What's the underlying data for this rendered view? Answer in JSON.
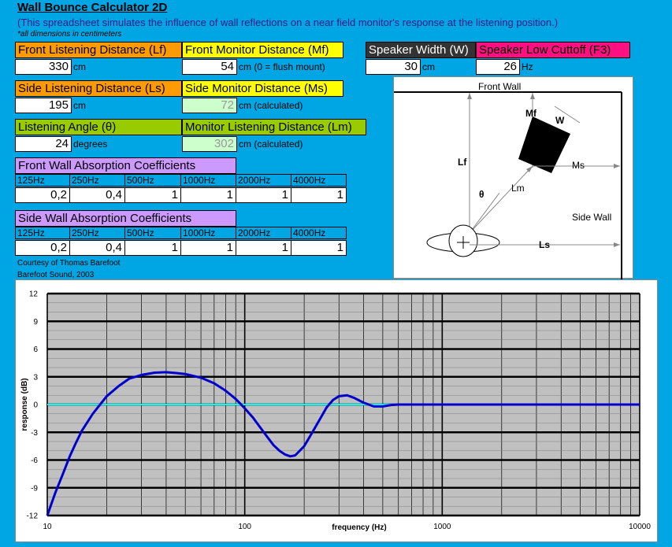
{
  "header": {
    "title": "Wall Bounce Calculator 2D",
    "subtitle": "(This spreadsheet simulates the influence of wall reflections on a near field monitor's response at the listening position.)",
    "note": "*all dimensions in centimeters"
  },
  "inputs": {
    "front_listening": {
      "label": "Front Listening Distance (Lf)",
      "value": "330",
      "unit": "cm"
    },
    "front_monitor": {
      "label": "Front Monitor Distance (Mf)",
      "value": "54",
      "unit": "cm  (0 = flush mount)"
    },
    "speaker_width": {
      "label": "Speaker Width (W)",
      "value": "30",
      "unit": "cm"
    },
    "low_cutoff": {
      "label": "Speaker Low Cuttoff (F3)",
      "value": "26",
      "unit": "Hz"
    },
    "side_listening": {
      "label": "Side Listening Distance (Ls)",
      "value": "195",
      "unit": "cm"
    },
    "side_monitor": {
      "label": "Side Monitor Distance (Ms)",
      "value": "72",
      "unit": "cm  (calculated)"
    },
    "listening_angle": {
      "label": "Listening Angle (θ)",
      "value": "24",
      "unit": "degrees"
    },
    "monitor_listening": {
      "label": "Monitor Listening Distance (Lm)",
      "value": "302",
      "unit": "cm  (calculated)"
    }
  },
  "absorption": {
    "front": {
      "label": "Front Wall Absorption Coefficients",
      "bands": [
        "125Hz",
        "250Hz",
        "500Hz",
        "1000Hz",
        "2000Hz",
        "4000Hz"
      ],
      "values": [
        "0,2",
        "0,4",
        "1",
        "1",
        "1",
        "1"
      ]
    },
    "side": {
      "label": "Side Wall Absorption Coefficients",
      "bands": [
        "125Hz",
        "250Hz",
        "500Hz",
        "1000Hz",
        "2000Hz",
        "4000Hz"
      ],
      "values": [
        "0,2",
        "0,4",
        "1",
        "1",
        "1",
        "1"
      ]
    }
  },
  "credits": {
    "line1": "Courtesy of Thomas Barefoot",
    "line2": "Barefoot Sound, 2003"
  },
  "diagram": {
    "front_wall": "Front Wall",
    "side_wall": "Side Wall",
    "lf": "Lf",
    "mf": "Mf",
    "w": "W",
    "ms": "Ms",
    "lm": "Lm",
    "theta": "θ",
    "ls": "Ls"
  },
  "colors": {
    "background": "#00a6e4",
    "response_curve": "#0000cc",
    "zero_line": "#00ffff",
    "plot_area": "#c0c0c0"
  },
  "chart_data": {
    "type": "line",
    "title": "",
    "xlabel": "frequency (Hz)",
    "ylabel": "response (dB)",
    "x_scale": "log",
    "xlim": [
      10,
      10000
    ],
    "ylim": [
      -12,
      12
    ],
    "x_tick_labels": [
      "10",
      "100",
      "1000",
      "10000"
    ],
    "y_ticks": [
      -12,
      -9,
      -6,
      -3,
      0,
      3,
      6,
      9,
      12
    ],
    "y_tick_labels": [
      "-12",
      "-9",
      "-6",
      "-3",
      "0",
      "3",
      "6",
      "9",
      "12"
    ],
    "grid": true,
    "legend": "none",
    "series": [
      {
        "x": [
          10,
          11,
          12,
          13,
          14,
          15,
          17,
          20,
          23,
          26,
          30,
          35,
          40,
          45,
          50,
          60,
          70,
          80,
          90,
          100,
          110,
          120,
          130,
          140,
          150,
          160,
          170,
          180,
          200,
          220,
          240,
          260,
          280,
          300,
          330,
          360,
          400,
          450,
          500,
          550,
          600,
          700,
          800,
          1000,
          2000,
          5000,
          10000
        ],
        "y": [
          -12,
          -9.5,
          -7.5,
          -5.6,
          -4.1,
          -2.8,
          -1.0,
          0.9,
          2.0,
          2.8,
          3.2,
          3.45,
          3.5,
          3.4,
          3.3,
          2.9,
          2.3,
          1.5,
          0.6,
          -0.4,
          -1.4,
          -2.5,
          -3.5,
          -4.4,
          -5.0,
          -5.4,
          -5.6,
          -5.5,
          -4.5,
          -3.0,
          -1.6,
          -0.3,
          0.5,
          0.9,
          1.0,
          0.7,
          0.2,
          -0.2,
          -0.2,
          -0.05,
          0,
          0,
          0,
          0,
          0,
          0,
          0
        ]
      },
      {
        "x": [
          10,
          10000
        ],
        "y": [
          0,
          0
        ]
      }
    ]
  }
}
